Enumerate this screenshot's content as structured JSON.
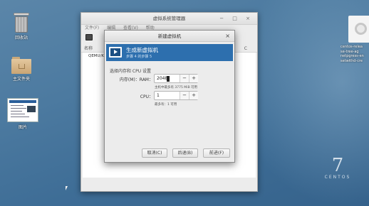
{
  "desktop": {
    "icons": [
      {
        "label": "回收站"
      },
      {
        "label": "主文件夹"
      },
      {
        "label": "图片"
      }
    ],
    "right_file_lines": [
      "centos-relea",
      "se-tree-ag",
      "netpgress-en",
      "setwithd-cre"
    ],
    "brand": {
      "seven": "7",
      "word": "CENTOS"
    }
  },
  "vmm": {
    "title": "虚拟系统管理器",
    "menu": [
      "文件(F)",
      "编辑",
      "查看(V)",
      "帮助"
    ],
    "header_name": "名称",
    "header_cpu": "C",
    "rows": [
      "QEMU/KVM"
    ]
  },
  "dialog": {
    "title": "新建虚拟机",
    "close": "×",
    "banner_title": "生成新虚拟机",
    "banner_step": "步骤 4 的步骤 5",
    "section_label": "选择内存和 CPU 设置",
    "memory_label": "内存(M)：RAM：",
    "memory_value": "2048",
    "memory_note": "主机中最多有 3775 MiB 可用",
    "cpu_label": "CPU：",
    "cpu_value": "1",
    "cpu_note": "最多有：1 可用",
    "minus": "−",
    "plus": "+",
    "buttons": {
      "cancel": "取消(C)",
      "back": "后退(B)",
      "forward": "前进(F)"
    }
  }
}
